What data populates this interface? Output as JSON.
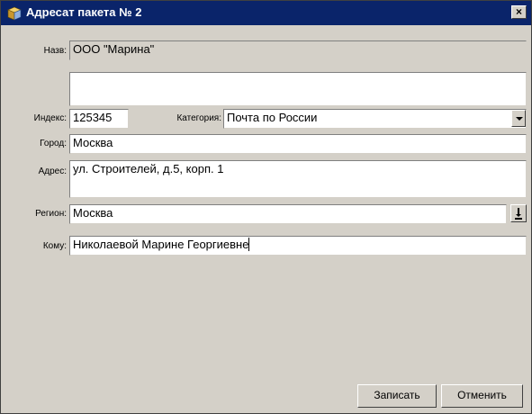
{
  "window": {
    "title": "Адресат пакета № 2",
    "close_label": "×"
  },
  "form": {
    "name": {
      "label": "Назв:",
      "value": "ООО \"Марина\""
    },
    "index": {
      "label": "Индекс:",
      "value": "125345"
    },
    "category": {
      "label": "Категория:",
      "value": "Почта по России"
    },
    "city": {
      "label": "Город:",
      "value": "Москва"
    },
    "address": {
      "label": "Адрес:",
      "value": "ул. Строителей, д.5, корп. 1"
    },
    "region": {
      "label": "Регион:",
      "value": "Москва"
    },
    "recipient": {
      "label": "Кому:",
      "value": "Николаевой Марине Георгиевне"
    }
  },
  "buttons": {
    "save": "Записать",
    "cancel": "Отменить"
  },
  "colors": {
    "titlebar": "#0a246a",
    "face": "#d4d0c8"
  }
}
